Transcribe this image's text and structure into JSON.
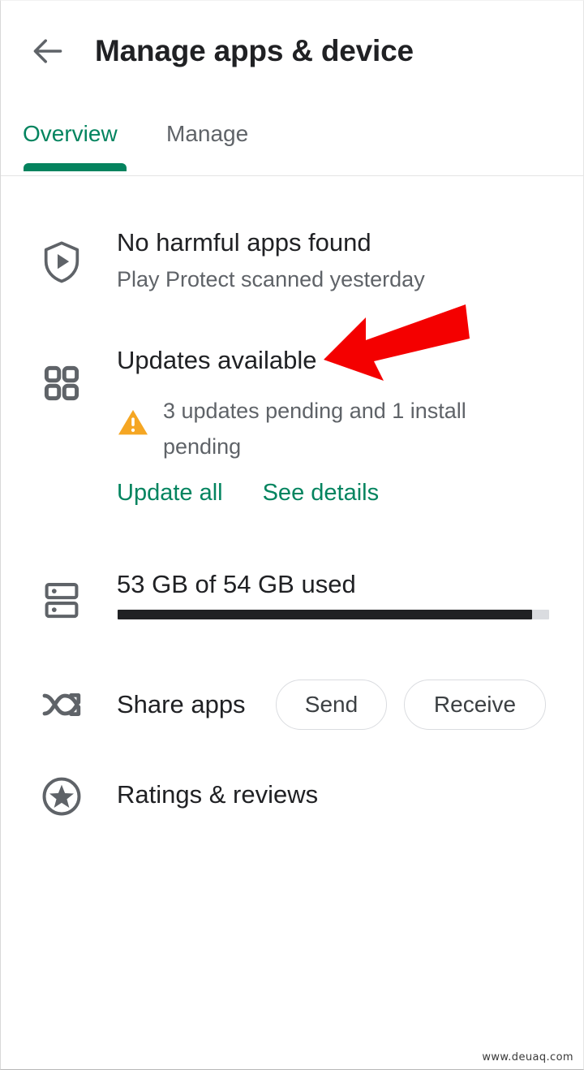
{
  "appbar": {
    "back_icon": "arrow-left-icon",
    "title": "Manage apps & device"
  },
  "tabs": {
    "items": [
      {
        "label": "Overview",
        "active": true
      },
      {
        "label": "Manage",
        "active": false
      }
    ],
    "active_color": "#04835e",
    "inactive_color": "#5f6368"
  },
  "rows": {
    "play_protect": {
      "icon": "shield-play-icon",
      "title": "No harmful apps found",
      "subtitle": "Play Protect scanned yesterday"
    },
    "updates": {
      "icon": "grid-apps-icon",
      "title": "Updates available",
      "warning_icon": "warning-triangle-icon",
      "warning_text": "3 updates pending and 1 install pending",
      "actions": [
        {
          "label": "Update all"
        },
        {
          "label": "See details"
        }
      ]
    },
    "storage": {
      "icon": "storage-icon",
      "title": "53 GB of 54 GB used",
      "used_gb": 53,
      "total_gb": 54,
      "percent": 96,
      "fill_color": "#202124",
      "track_color": "#dadce0"
    },
    "share_apps": {
      "icon": "share-apps-icon",
      "title": "Share apps",
      "buttons": [
        {
          "label": "Send"
        },
        {
          "label": "Receive"
        }
      ]
    },
    "ratings": {
      "icon": "star-circle-icon",
      "title": "Ratings & reviews"
    }
  },
  "annotation": {
    "arrow_icon": "red-arrow-left-icon",
    "color": "#f40000"
  },
  "watermark": {
    "text": "www.deuaq.com"
  }
}
